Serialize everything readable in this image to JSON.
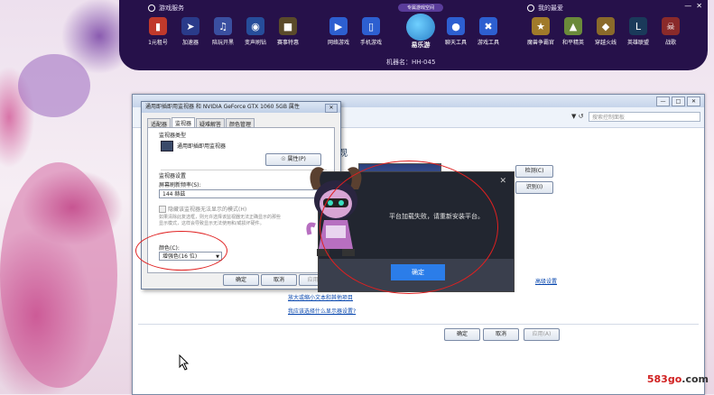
{
  "launcher": {
    "section_left": "游戏服务",
    "section_right": "我的最爱",
    "left_items": [
      {
        "label": "1元租号",
        "icon": "rent-icon"
      },
      {
        "label": "加速器",
        "icon": "rocket-icon"
      },
      {
        "label": "陪玩开黑",
        "icon": "headset-icon"
      },
      {
        "label": "变声刷钻",
        "icon": "voice-icon"
      },
      {
        "label": "赛事特惠",
        "icon": "pubg-icon"
      }
    ],
    "mid_items": [
      {
        "label": "网络游戏",
        "icon": "gamepad-icon"
      },
      {
        "label": "手机游戏",
        "icon": "phone-icon"
      }
    ],
    "center_badge": "专属游戏空间",
    "center_name": "易乐游",
    "right_mid_items": [
      {
        "label": "聊天工具",
        "icon": "chat-icon"
      },
      {
        "label": "游戏工具",
        "icon": "tools-icon"
      }
    ],
    "fav_items": [
      {
        "label": "魔兽争霸官",
        "icon": "warcraft-icon"
      },
      {
        "label": "和平精英",
        "icon": "peace-icon"
      },
      {
        "label": "穿越火线",
        "icon": "cf-icon"
      },
      {
        "label": "英雄联盟",
        "icon": "lol-icon"
      },
      {
        "label": "战歌",
        "icon": "battle-icon"
      }
    ],
    "machine": "机器名：HH-045"
  },
  "control_panel": {
    "search_placeholder": "搜索控制面板",
    "heading": "观",
    "detect_label": "检测(C)",
    "identify_label": "识别(I)",
    "advanced_link": "高级设置",
    "link1": "放大或缩小文本和其他项目",
    "link2": "我应该选择什么显示器设置?",
    "ok_label": "确定",
    "cancel_label": "取消",
    "apply_label": "应用(A)"
  },
  "dialog": {
    "title": "通用即插即用监视器 和 NVIDIA GeForce GTX 1060 5GB 属性",
    "tabs": [
      "适配器",
      "监视器",
      "疑难解答",
      "颜色管理"
    ],
    "active_tab": 1,
    "monitor_type_label": "监视器类型",
    "monitor_name": "通用即插即用监视器",
    "properties_label": "属性(P)",
    "settings_label": "监视器设置",
    "refresh_label": "屏幕刷新频率(S):",
    "refresh_value": "144 赫兹",
    "hide_modes_label": "隐藏该监视器无法显示的模式(H)",
    "hide_desc_1": "如果清除此复选框，则允许选择该监视器无法正确显示的那些",
    "hide_desc_2": "显示模式，这样会导致显示无法使用和/或损坏硬件。",
    "color_label": "颜色(C):",
    "color_value": "增强色(16 位)",
    "ok_label": "确定",
    "cancel_label": "取消",
    "apply_label": "应用(A)"
  },
  "popup": {
    "message": "平台加载失败，请重新安装平台。",
    "ok_label": "确定"
  },
  "watermark": {
    "main": "583go",
    "suffix": ".com"
  }
}
